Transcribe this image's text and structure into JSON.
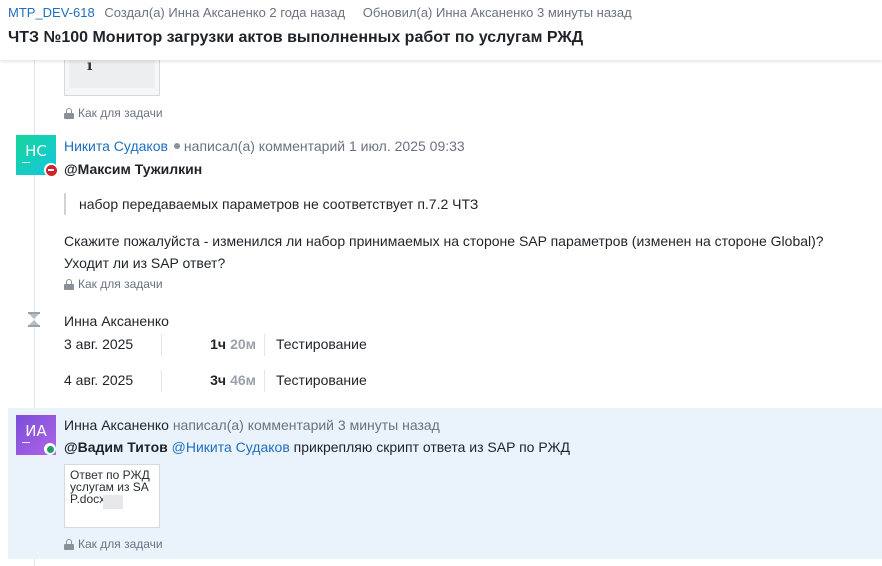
{
  "header": {
    "issue_key": "MTP_DEV-618",
    "created": "Создал(а) Инна Аксаненко 2 года назад",
    "updated": "Обновил(а) Инна Аксаненко 3 минуты назад",
    "title": "ЧТЗ №100 Монитор загрузки актов выполненных работ по услугам РЖД"
  },
  "top_attachment": {
    "glyph": "ı"
  },
  "visibility_label": "Как для задачи",
  "comment1": {
    "avatar_initials": "НС",
    "author": "Никита Судаков",
    "action": "написал(а) комментарий 1 июл. 2025 09:33",
    "mention": "@Максим Тужилкин",
    "quote": "набор передаваемых параметров не соответствует п.7.2 ЧТЗ",
    "line1": "Скажите пожалуйста - изменился ли набор принимаемых на стороне SAP параметров (изменен на стороне Global)?",
    "line2": "Уходит ли из SAP ответ?",
    "visibility": "Как для задачи"
  },
  "worklog": {
    "author": "Инна Аксаненко",
    "entries": [
      {
        "date": "3 авг. 2025",
        "hours": "1ч",
        "minutes": "20м",
        "type": "Тестирование"
      },
      {
        "date": "4 авг. 2025",
        "hours": "3ч",
        "minutes": "46м",
        "type": "Тестирование"
      }
    ]
  },
  "comment2": {
    "avatar_initials": "ИА",
    "author": "Инна Аксаненко",
    "action": "написал(а) комментарий 3 минуты назад",
    "mention1": "@Вадим Титов",
    "mention2": "@Никита Судаков",
    "text": "прикрепляю скрипт ответа из SAP по РЖД",
    "attachment": "Ответ по РЖД услугам из SAP.docx",
    "visibility": "Как для задачи"
  },
  "colors": {
    "link": "#1f6fbf",
    "highlight": "#eaf3fc",
    "status_busy": "#d3212c",
    "status_online": "#1f9e6b"
  }
}
